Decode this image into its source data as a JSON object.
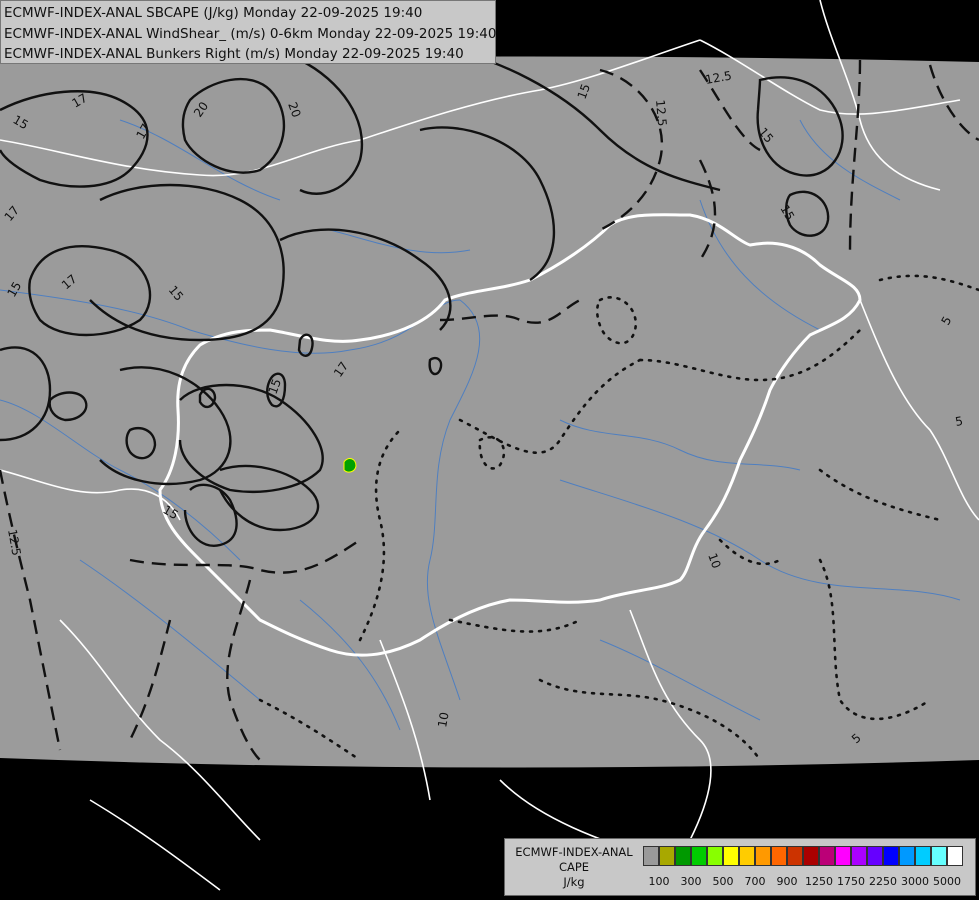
{
  "title_lines": [
    "ECMWF-INDEX-ANAL SBCAPE (J/kg) Monday 22-09-2025 19:40",
    "ECMWF-INDEX-ANAL WindShear_ (m/s) 0-6km Monday 22-09-2025 19:40",
    "ECMWF-INDEX-ANAL Bunkers Right (m/s) Monday 22-09-2025 19:40"
  ],
  "legend": {
    "title_lines": [
      "ECMWF-INDEX-ANAL",
      "CAPE",
      "J/kg"
    ],
    "colors": [
      "#9a9a9a",
      "#a8a800",
      "#009900",
      "#00cc00",
      "#88ff00",
      "#ffff00",
      "#ffcc00",
      "#ff9900",
      "#ff6600",
      "#cc3300",
      "#aa0000",
      "#bb0077",
      "#ff00ff",
      "#aa00ff",
      "#6600ff",
      "#0000ff",
      "#0099ff",
      "#00ccff",
      "#66ffff",
      "#ffffff"
    ],
    "tick_labels": [
      "100",
      "300",
      "500",
      "700",
      "900",
      "1250",
      "1750",
      "2250",
      "3000",
      "5000"
    ]
  },
  "contour_labels": {
    "windshear": [
      "17",
      "20",
      "20",
      "17",
      "17",
      "15",
      "15",
      "15",
      "15",
      "15",
      "17",
      "17"
    ],
    "bunkers": [
      "12.5",
      "12.5",
      "15",
      "15",
      "15",
      "12.5",
      "10",
      "10",
      "5",
      "5",
      "5"
    ]
  },
  "colors": {
    "land": "#9b9b9b",
    "outside": "#000000",
    "borders": "#ffffff",
    "rivers": "#4f7fc0",
    "contours": "#111111",
    "cape_spot": "#00a000"
  }
}
